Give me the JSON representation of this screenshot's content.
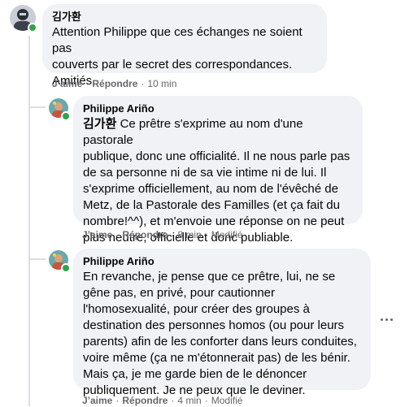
{
  "comments": [
    {
      "author": "김가환",
      "text_lines": [
        "Attention Philippe que ces échanges ne soient pas",
        "couverts par le secret des correspondances.",
        "Amitiés"
      ],
      "actions": {
        "like": "J’aime",
        "reply": "Répondre",
        "time": "10 min"
      }
    },
    {
      "author": "Philippe Ariño",
      "mention": "김가환",
      "text_first": " Ce prêtre s'exprime au nom d'une pastorale",
      "text_lines": [
        "publique, donc une officialité. Il ne nous parle pas",
        "de sa personne ni de sa vie intime ni de lui. Il",
        "s'exprime officiellement, au nom de l'évêché de",
        "Metz, de la Pastorale des Familles (et ça fait du",
        "nombre!^^), et m'envoie une réponse on ne peut",
        "plus neutre, officielle et donc publiable."
      ],
      "actions": {
        "like": "J’aime",
        "reply": "Répondre",
        "time": "8 min",
        "edited": "Modifié"
      }
    },
    {
      "author": "Philippe Ariño",
      "text_lines": [
        "En revanche, je pense que ce prêtre, lui, ne se",
        "gêne pas, en privé, pour cautionner",
        "l'homosexualité, pour créer des groupes à",
        "destination des personnes homos (ou pour leurs",
        "parents) afin de les conforter dans leurs conduites,",
        "voire même (ça ne m'étonnerait pas) de les bénir.",
        "Mais ça, je me garde bien de le dénoncer",
        "publiquement. Je ne peux que le deviner."
      ],
      "actions": {
        "like": "J’aime",
        "reply": "Répondre",
        "time": "4 min",
        "edited": "Modifié"
      }
    }
  ],
  "icons": {
    "more": "more-horizontal-icon",
    "online": "online-status-dot"
  },
  "colors": {
    "bubble": "#f0f2f5",
    "online": "#31a24c",
    "meta": "#65676b",
    "thread": "#dadde1"
  }
}
